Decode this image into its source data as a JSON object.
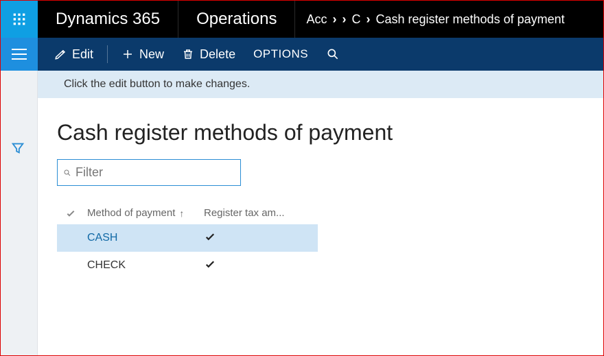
{
  "topbar": {
    "brand": "Dynamics 365",
    "module": "Operations"
  },
  "breadcrumbs": {
    "seg1": "Acc",
    "seg2": "C",
    "seg3": "Cash register methods of payment"
  },
  "actions": {
    "edit": "Edit",
    "new": "New",
    "delete": "Delete",
    "options": "OPTIONS"
  },
  "info_message": "Click the edit button to make changes.",
  "page_title": "Cash register methods of payment",
  "filter": {
    "placeholder": "Filter",
    "value": ""
  },
  "grid": {
    "columns": {
      "method": "Method of payment",
      "register": "Register tax am..."
    },
    "rows": [
      {
        "method": "CASH",
        "register_tax": true,
        "selected": true
      },
      {
        "method": "CHECK",
        "register_tax": true,
        "selected": false
      }
    ]
  }
}
